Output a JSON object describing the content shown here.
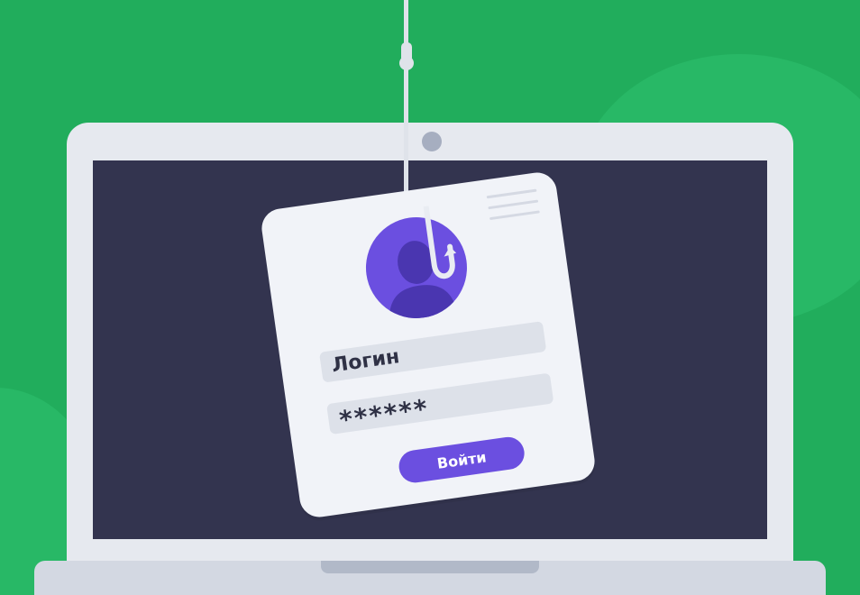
{
  "login_card": {
    "login_placeholder": "Логин",
    "password_value": "******",
    "submit_label": "Войти"
  },
  "colors": {
    "background": "#21ad5c",
    "screen": "#33344f",
    "accent": "#6b4fe0",
    "card": "#f1f3f8"
  },
  "icons": [
    "fishing-hook-icon",
    "user-avatar-icon",
    "camera-dot"
  ]
}
